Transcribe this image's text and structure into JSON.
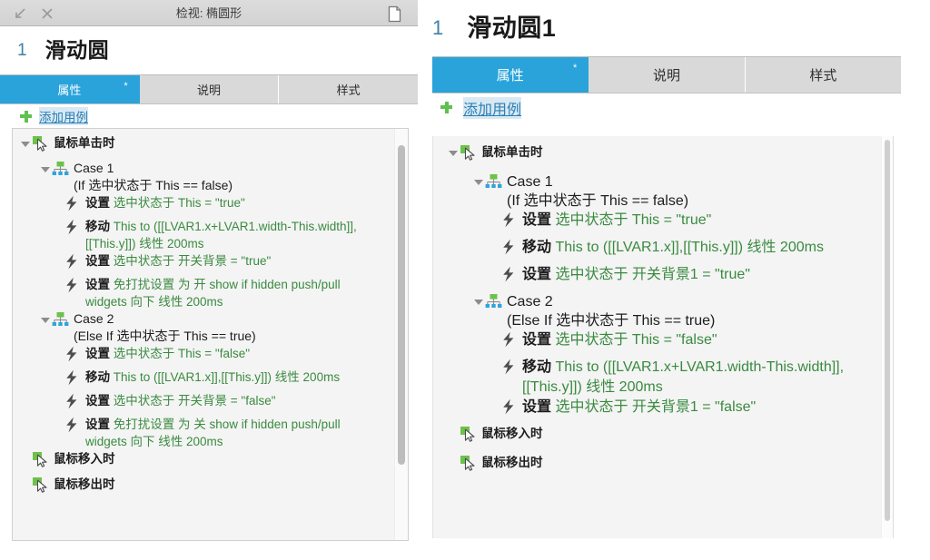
{
  "left_panel": {
    "titlebar": {
      "title": "检视: 椭圆形",
      "minimize_icon": "minimize-arrow-icon",
      "close_icon": "close-icon",
      "doc_icon": "document-icon"
    },
    "object": {
      "index": "1",
      "name": "滑动圆"
    },
    "tabs": [
      {
        "label": "属性",
        "active": true,
        "modified_marker": "*"
      },
      {
        "label": "说明",
        "active": false
      },
      {
        "label": "样式",
        "active": false
      }
    ],
    "add_case_label": "添加用例",
    "tree": [
      {
        "type": "event",
        "label": "鼠标单击时"
      },
      {
        "type": "case",
        "label": "Case 1",
        "condition": "(If 选中状态于 This == false)"
      },
      {
        "type": "action",
        "verb": "设置",
        "text": "选中状态于 This = \"true\""
      },
      {
        "type": "action",
        "verb": "移动",
        "text": "This to ([[LVAR1.x+LVAR1.width-This.width]],[[This.y]]) 线性 200ms"
      },
      {
        "type": "action",
        "verb": "设置",
        "text": "选中状态于 开关背景 = \"true\""
      },
      {
        "type": "action",
        "verb": "设置",
        "text": "免打扰设置 为 开 show if hidden push/pull widgets 向下 线性 200ms"
      },
      {
        "type": "case",
        "label": "Case 2",
        "condition": "(Else If 选中状态于 This == true)"
      },
      {
        "type": "action",
        "verb": "设置",
        "text": "选中状态于 This = \"false\""
      },
      {
        "type": "action",
        "verb": "移动",
        "text": "This to ([[LVAR1.x]],[[This.y]]) 线性 200ms"
      },
      {
        "type": "action",
        "verb": "设置",
        "text": "选中状态于 开关背景 = \"false\""
      },
      {
        "type": "action",
        "verb": "设置",
        "text": "免打扰设置 为 关 show if hidden push/pull widgets 向下 线性 200ms"
      },
      {
        "type": "event",
        "label": "鼠标移入时"
      },
      {
        "type": "event",
        "label": "鼠标移出时"
      }
    ]
  },
  "right_panel": {
    "object": {
      "index": "1",
      "name": "滑动圆1"
    },
    "tabs": [
      {
        "label": "属性",
        "active": true,
        "modified_marker": "*"
      },
      {
        "label": "说明",
        "active": false
      },
      {
        "label": "样式",
        "active": false
      }
    ],
    "add_case_label": "添加用例",
    "tree": [
      {
        "type": "event",
        "label": "鼠标单击时"
      },
      {
        "type": "case",
        "label": "Case 1",
        "condition": "(If 选中状态于 This == false)"
      },
      {
        "type": "action",
        "verb": "设置",
        "text": "选中状态于 This = \"true\""
      },
      {
        "type": "action",
        "verb": "移动",
        "text": "This to ([[LVAR1.x]],[[This.y]]) 线性 200ms"
      },
      {
        "type": "action",
        "verb": "设置",
        "text": "选中状态于 开关背景1 = \"true\""
      },
      {
        "type": "case",
        "label": "Case 2",
        "condition": "(Else If 选中状态于 This == true)"
      },
      {
        "type": "action",
        "verb": "设置",
        "text": "选中状态于 This = \"false\""
      },
      {
        "type": "action",
        "verb": "移动",
        "text": "This to ([[LVAR1.x+LVAR1.width-This.width]],[[This.y]]) 线性 200ms"
      },
      {
        "type": "action",
        "verb": "设置",
        "text": "选中状态于 开关背景1 = \"false\""
      },
      {
        "type": "event",
        "label": "鼠标移入时"
      },
      {
        "type": "event",
        "label": "鼠标移出时"
      }
    ]
  },
  "colors": {
    "accent_blue": "#29a3da",
    "link_blue": "#2b7fb5",
    "action_green": "#3a8a3f",
    "plus_green": "#5fc14e",
    "tab_inactive": "#d9d9d9",
    "tree_bg": "#f4f4f4"
  }
}
